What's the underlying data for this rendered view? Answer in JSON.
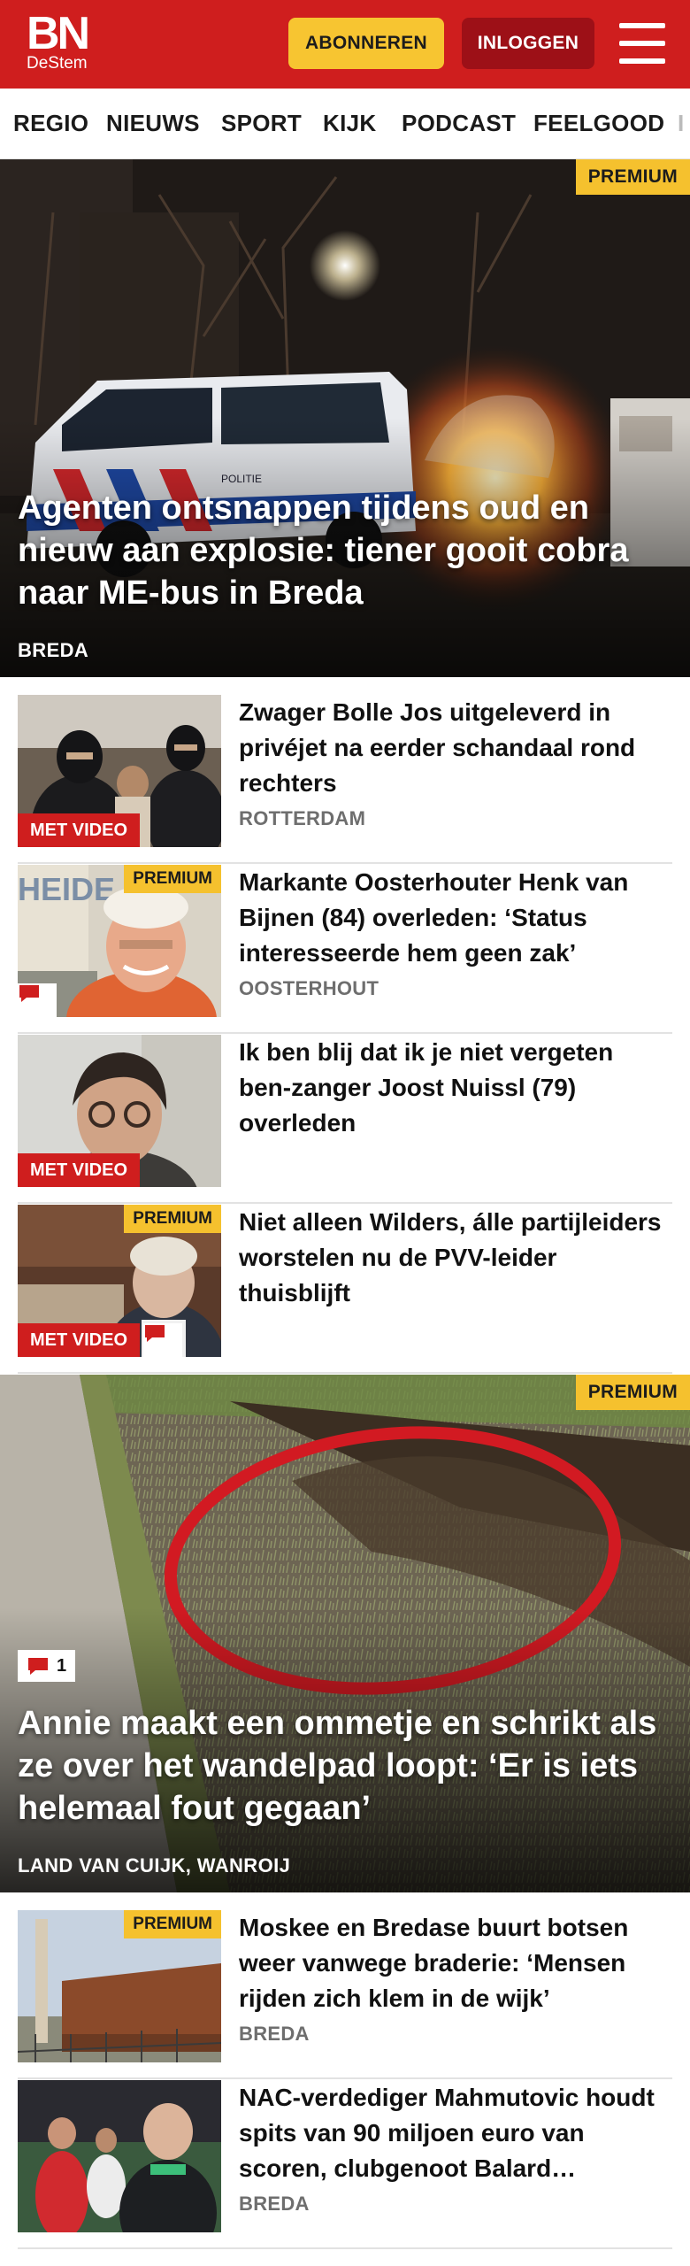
{
  "header": {
    "logo_main": "BN",
    "logo_sub": "DeStem",
    "subscribe_label": "ABONNEREN",
    "login_label": "INLOGGEN"
  },
  "nav": {
    "items": [
      "REGIO",
      "NIEUWS",
      "SPORT",
      "KIJK",
      "PODCAST",
      "FEELGOOD",
      "I"
    ]
  },
  "badges": {
    "premium": "PREMIUM",
    "video": "MET VIDEO"
  },
  "hero1": {
    "title": "Agenten ontsnappen tijdens oud en nieuw aan explosie: tiener gooit cobra naar ME-bus in Breda",
    "location": "BREDA"
  },
  "articles": [
    {
      "title": "Zwager Bolle Jos uitgeleverd in privéjet na eerder schandaal rond rechters",
      "location": "ROTTERDAM"
    },
    {
      "title": "Markante Oosterhouter Henk van Bijnen (84) overleden: ‘Status interesseerde hem geen zak’",
      "location": "OOSTERHOUT"
    },
    {
      "title": "Ik ben blij dat ik je niet vergeten ben-zanger Joost Nuissl (79) overleden",
      "location": ""
    },
    {
      "title": "Niet alleen Wilders, álle partijlei­ders worstelen nu de PVV-leider thuisblijft",
      "location": ""
    }
  ],
  "hero2": {
    "title": "Annie maakt een ommetje en schrikt als ze over het wandelpad loopt: ‘Er is iets helemaal fout gegaan’",
    "location": "LAND VAN CUIJK, WANROIJ",
    "comment_count": "1"
  },
  "articles2": [
    {
      "title": "Moskee en Bredase buurt botsen weer vanwege braderie: ‘Mensen rijden zich klem in de wijk’",
      "location": "BREDA"
    },
    {
      "title": "NAC-verdediger Mahmutovic houdt spits van 90 miljoen euro van scoren, clubgenoot Balard…",
      "location": "BREDA"
    }
  ],
  "colors": {
    "brand_red": "#cf1e1e",
    "premium_yellow": "#f5c12e",
    "login_dark_red": "#9d1017"
  },
  "icons": [
    "hamburger-menu-icon",
    "comment-icon"
  ]
}
